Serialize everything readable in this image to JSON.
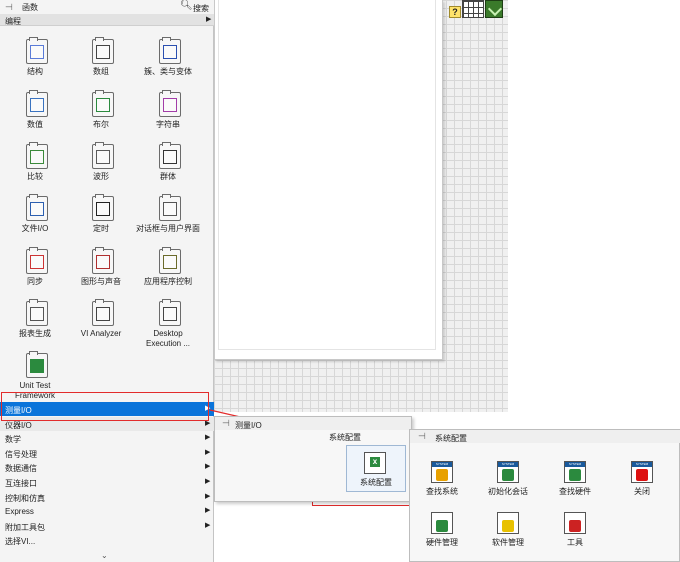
{
  "palette": {
    "title": "函数",
    "search_label": "搜索",
    "category_header": "编程",
    "tiles": [
      {
        "label": "结构",
        "icon": "structures-icon"
      },
      {
        "label": "数组",
        "icon": "array-icon"
      },
      {
        "label": "簇、类与变体",
        "icon": "cluster-icon"
      },
      {
        "label": "数值",
        "icon": "numeric-icon"
      },
      {
        "label": "布尔",
        "icon": "boolean-icon"
      },
      {
        "label": "字符串",
        "icon": "string-icon"
      },
      {
        "label": "比较",
        "icon": "comparison-icon"
      },
      {
        "label": "波形",
        "icon": "waveform-icon"
      },
      {
        "label": "群体",
        "icon": "group-icon"
      },
      {
        "label": "文件I/O",
        "icon": "file-io-icon"
      },
      {
        "label": "定时",
        "icon": "timing-icon"
      },
      {
        "label": "对话框与用户界面",
        "icon": "dialog-icon"
      },
      {
        "label": "同步",
        "icon": "sync-icon"
      },
      {
        "label": "图形与声音",
        "icon": "graphics-icon"
      },
      {
        "label": "应用程序控制",
        "icon": "app-control-icon"
      },
      {
        "label": "报表生成",
        "icon": "report-icon"
      },
      {
        "label": "VI Analyzer",
        "icon": "vi-analyzer-icon"
      },
      {
        "label": "Desktop Execution ...",
        "icon": "desktop-exec-icon"
      },
      {
        "label": "Unit Test Framework",
        "icon": "unit-test-icon"
      }
    ],
    "rows": [
      {
        "label": "测量I/O"
      },
      {
        "label": "仪器I/O"
      },
      {
        "label": "数学"
      },
      {
        "label": "信号处理"
      },
      {
        "label": "数据通信"
      },
      {
        "label": "互连接口"
      },
      {
        "label": "控制和仿真"
      },
      {
        "label": "Express"
      },
      {
        "label": "附加工具包"
      },
      {
        "label": "选择VI..."
      }
    ],
    "arrow": "▶",
    "scroll_arrow": "⌄"
  },
  "submenu1": {
    "title": "测量I/O",
    "section": "系统配置",
    "item_label": "系统配置"
  },
  "submenu2": {
    "title": "系统配置",
    "band_text": "SYSTEM",
    "items": [
      {
        "label": "查找系统"
      },
      {
        "label": "初始化会话"
      },
      {
        "label": "查找硬件"
      },
      {
        "label": "关闭"
      },
      {
        "label": "硬件管理"
      },
      {
        "label": "软件管理"
      },
      {
        "label": "工具"
      }
    ]
  },
  "toolbar": {
    "help_label": "?"
  },
  "colors": {
    "selection": "#0a74da",
    "highlight_box": "#e22b2b"
  }
}
